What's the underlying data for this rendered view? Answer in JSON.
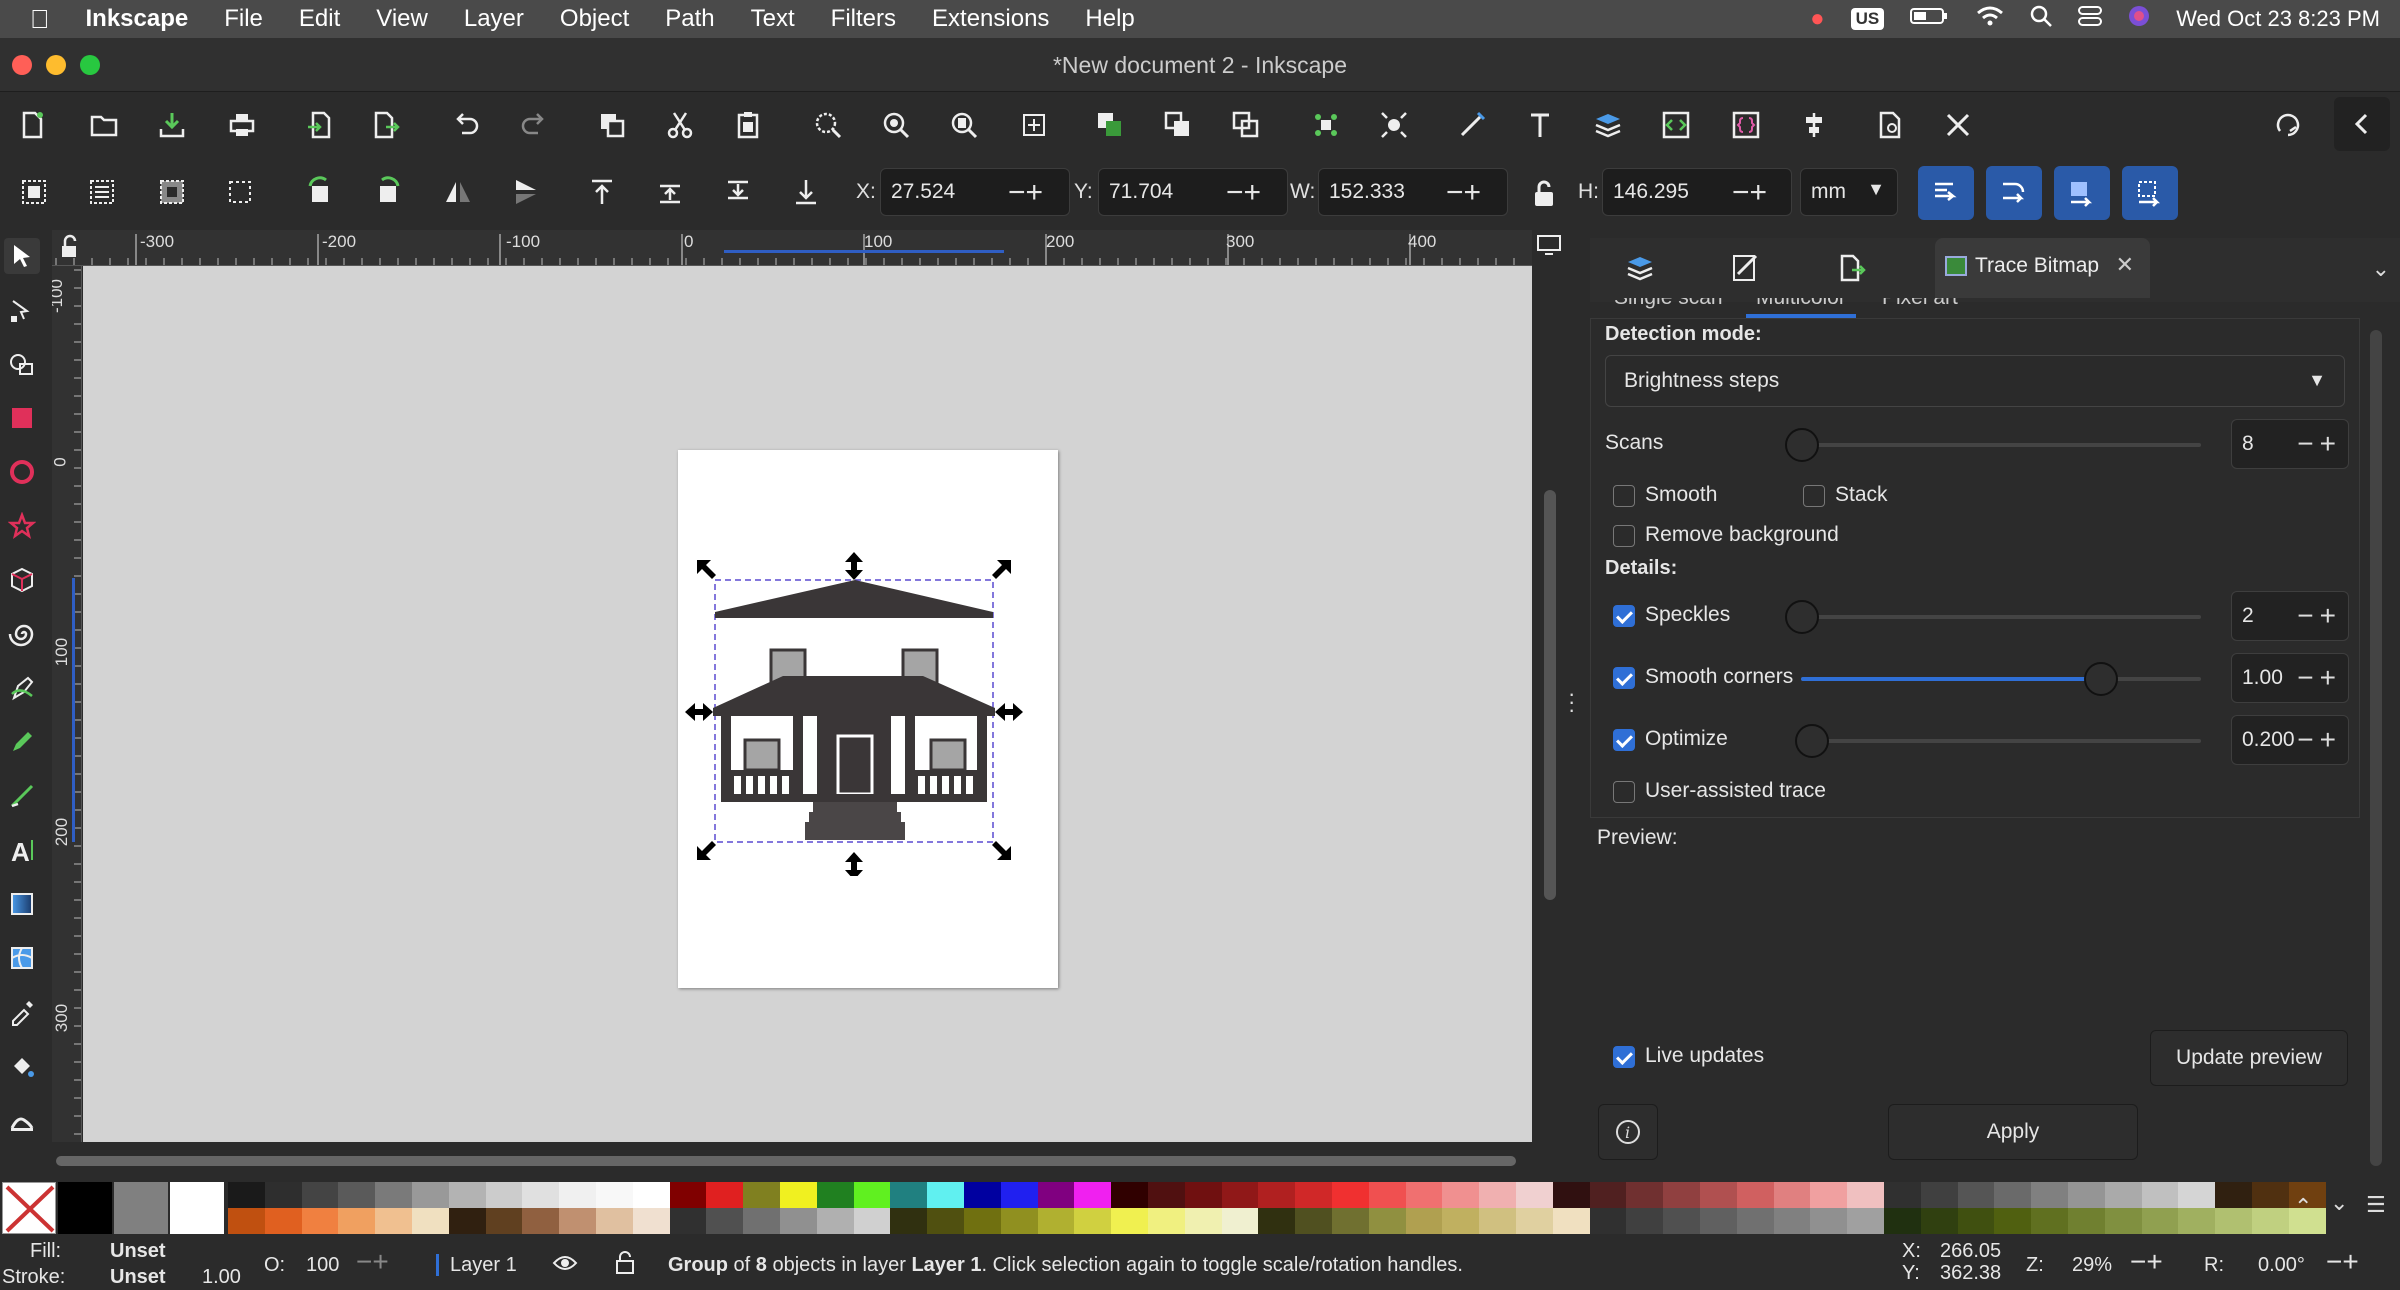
{
  "menubar": {
    "app_name": "Inkscape",
    "menus": [
      "File",
      "Edit",
      "View",
      "Layer",
      "Object",
      "Path",
      "Text",
      "Filters",
      "Extensions",
      "Help"
    ],
    "input_source": "US",
    "clock": "Wed Oct 23  8:23 PM"
  },
  "window": {
    "title": "*New document 2 - Inkscape"
  },
  "controls": {
    "x_label": "X:",
    "x_value": "27.524",
    "y_label": "Y:",
    "y_value": "71.704",
    "w_label": "W:",
    "w_value": "152.333",
    "h_label": "H:",
    "h_value": "146.295",
    "unit": "mm"
  },
  "rulers": {
    "h_labels": [
      "-300",
      "-200",
      "-100",
      "0",
      "100",
      "200",
      "300",
      "400"
    ],
    "v_labels": [
      "-100",
      "0",
      "100",
      "200",
      "300"
    ]
  },
  "dock": {
    "tab_label": "Trace Bitmap",
    "subtabs": [
      "Single scan",
      "Multicolor",
      "Pixel art"
    ],
    "detection_mode_label": "Detection mode:",
    "detection_mode_value": "Brightness steps",
    "scans_label": "Scans",
    "scans_value": "8",
    "smooth_label": "Smooth",
    "stack_label": "Stack",
    "remove_bg_label": "Remove background",
    "details_label": "Details:",
    "speckles_label": "Speckles",
    "speckles_value": "2",
    "smooth_corners_label": "Smooth corners",
    "smooth_corners_value": "1.00",
    "optimize_label": "Optimize",
    "optimize_value": "0.200",
    "user_assisted_label": "User-assisted trace",
    "preview_label": "Preview:",
    "live_updates_label": "Live updates",
    "update_preview_label": "Update preview",
    "apply_label": "Apply",
    "checks": {
      "smooth": false,
      "stack": false,
      "remove_bg": false,
      "speckles": true,
      "smooth_corners": true,
      "optimize": true,
      "user_assisted": false,
      "live_updates": true
    },
    "levels": {
      "scans": 0.0,
      "speckles": 0.0,
      "smooth_corners": 0.75,
      "optimize": 0.0
    }
  },
  "status": {
    "fill_label": "Fill:",
    "fill_value": "Unset",
    "stroke_label": "Stroke:",
    "stroke_value": "Unset",
    "stroke_width": "1.00",
    "opacity_label": "O:",
    "opacity_value": "100",
    "layer_name": "Layer 1",
    "message_prefix": "Group",
    "message_mid1": " of ",
    "message_count": "8",
    "message_mid2": " objects in layer ",
    "message_layer": "Layer 1",
    "message_suffix": ". Click selection again to toggle scale/rotation handles.",
    "cursor_x_label": "X:",
    "cursor_x": "266.05",
    "cursor_y_label": "Y:",
    "cursor_y": "362.38",
    "zoom_label": "Z:",
    "zoom_value": "29%",
    "rotation_label": "R:",
    "rotation_value": "0.00°"
  },
  "colors": {
    "accent": "#2f6fd6",
    "house": "#3a3637",
    "window_gray": "#a5a5a5"
  }
}
